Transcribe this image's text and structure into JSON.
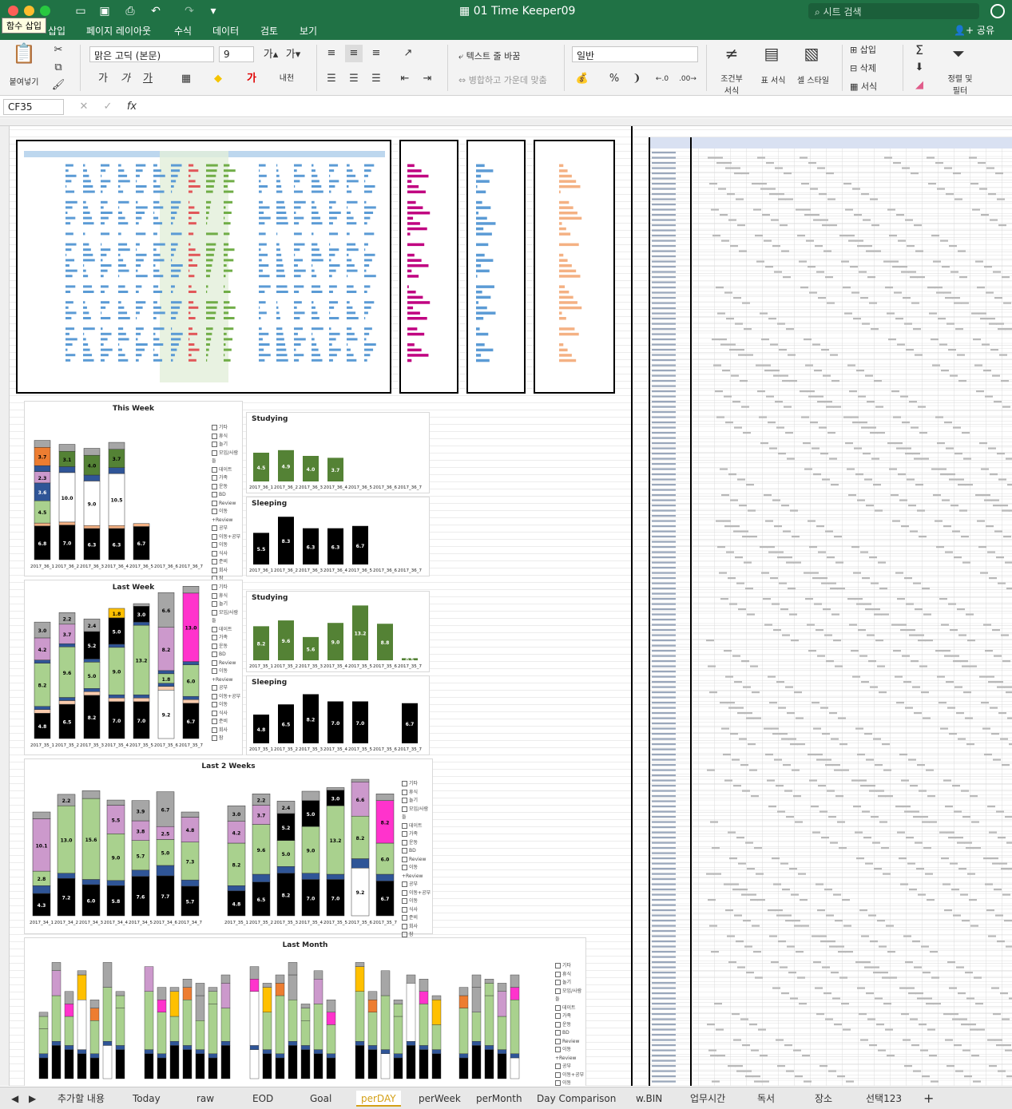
{
  "window": {
    "title": "01 Time Keeper09",
    "search_placeholder": "시트 검색"
  },
  "ribbon_tabs": [
    "삽입",
    "페이지 레이아웃",
    "수식",
    "데이터",
    "검토",
    "보기"
  ],
  "tooltip": "함수 삽입",
  "share_label": "공유",
  "ribbon": {
    "paste_label": "붙여넣기",
    "font_name": "맑은 고딕 (본문)",
    "font_size": "9",
    "wrap_text_label": "텍스트 줄 바꿈",
    "merge_center_label": "병합하고 가운데 맞춤",
    "number_format": "일반",
    "percent_symbol": "%",
    "conditional_format_label": "조건부\n서식",
    "table_format_label": "표 서식",
    "cell_style_label": "셀 스타일",
    "insert_label": "삽입",
    "delete_label": "삭제",
    "format_label": "서식",
    "sort_filter_label": "정렬 및\n필터",
    "bold_label": "가",
    "italic_label": "가",
    "underline_label": "가",
    "orientation_label": "내천"
  },
  "formula_bar": {
    "name_box": "CF35",
    "fx": "fx"
  },
  "charts": {
    "this_week": "This Week",
    "last_week": "Last Week",
    "last_2_weeks": "Last 2 Weeks",
    "last_month": "Last Month",
    "studying": "Studying",
    "sleeping": "Sleeping"
  },
  "legend_items": [
    "기타",
    "휴식",
    "놀기",
    "모임/사람들",
    "데이트",
    "가족",
    "운동",
    "BD",
    "Review",
    "이동+Review",
    "공부",
    "이동+공부",
    "이동",
    "식사",
    "준비",
    "회사",
    "잠"
  ],
  "colors": {
    "excel_green": "#207245",
    "sleep": "#000000",
    "study": "#a9d18e",
    "study_dark": "#548235",
    "move": "#2f5597",
    "play": "#cc99cc",
    "pink": "#ff33cc",
    "orange": "#ed7d31",
    "gray": "#a6a6a6",
    "gold": "#ffc000"
  },
  "this_week_bars": [
    {
      "label": "2017_36_1",
      "sleep": 6.8,
      "study": 4.5,
      "company": 3.7
    },
    {
      "label": "2017_36_2",
      "sleep": 7.0,
      "study": 10.0,
      "company": 3.1
    },
    {
      "label": "2017_36_3",
      "sleep": 6.3,
      "study": 9.0,
      "company": 4.0
    },
    {
      "label": "2017_36_4",
      "sleep": 6.3,
      "study": 10.5,
      "company": 3.7
    },
    {
      "label": "2017_36_5",
      "sleep": 6.7,
      "study": 0.0,
      "company": 0.0
    },
    {
      "label": "2017_36_6",
      "sleep": 0.0,
      "study": 0.0,
      "company": 0.0
    },
    {
      "label": "2017_36_7",
      "sleep": 0.0,
      "study": 0.0,
      "company": 0.0
    }
  ],
  "this_week_studying": [
    4.5,
    4.9,
    4.0,
    3.7,
    0,
    0,
    0
  ],
  "this_week_sleeping": [
    5.5,
    8.3,
    6.3,
    6.3,
    6.7,
    0,
    0
  ],
  "last_week_bars": [
    {
      "label": "2017_35_1",
      "sleep": 4.8,
      "study": 8.2,
      "play": 4.2,
      "top": 3.0
    },
    {
      "label": "2017_35_2",
      "sleep": 6.5,
      "study": 9.6,
      "play": 3.7,
      "top": 2.2
    },
    {
      "label": "2017_35_3",
      "sleep": 8.2,
      "study": 5.0,
      "play": 5.2,
      "top": 2.4
    },
    {
      "label": "2017_35_4",
      "sleep": 7.0,
      "study": 9.0,
      "play": 5.0,
      "top": 1.8
    },
    {
      "label": "2017_35_5",
      "sleep": 7.0,
      "study": 13.2,
      "play": 3.0,
      "top": 0.5
    },
    {
      "label": "2017_35_6",
      "sleep": 9.2,
      "study": 1.8,
      "play": 8.2,
      "top": 6.6
    },
    {
      "label": "2017_35_7",
      "sleep": 6.7,
      "study": 6.0,
      "play": 13.0,
      "top": 1.3
    }
  ],
  "last_week_studying": [
    8.2,
    9.6,
    5.6,
    9.0,
    13.2,
    8.8,
    0.5
  ],
  "last_week_sleeping": [
    4.8,
    6.5,
    8.2,
    7.0,
    7.0,
    0,
    6.7
  ],
  "last2_labels": [
    "2017_34_1",
    "2017_34_2",
    "2017_34_3",
    "2017_34_4",
    "2017_34_5",
    "2017_34_6",
    "2017_34_7",
    "2017_35_1",
    "2017_35_2",
    "2017_35_3",
    "2017_35_4",
    "2017_35_5",
    "2017_35_6",
    "2017_35_7"
  ],
  "sheet_tabs": [
    "추가할 내용",
    "Today",
    "raw",
    "EOD",
    "Goal",
    "perDAY",
    "perWeek",
    "perMonth",
    "Day Comparison",
    "w.BIN",
    "업무시간",
    "독서",
    "장소",
    "선택123"
  ],
  "active_sheet": "perDAY"
}
